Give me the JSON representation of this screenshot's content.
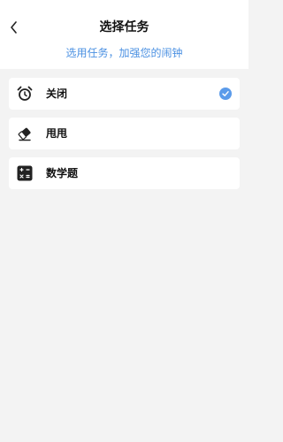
{
  "header": {
    "title": "选择任务",
    "subtitle": "选用任务，加强您的闹钟",
    "back_icon": "chevron-left-icon"
  },
  "tasks": [
    {
      "label": "关闭",
      "icon": "alarm-clock-icon",
      "selected": true
    },
    {
      "label": "甩甩",
      "icon": "eraser-icon",
      "selected": false
    },
    {
      "label": "数学题",
      "icon": "calculator-icon",
      "selected": false
    }
  ],
  "colors": {
    "accent": "#4a90e2",
    "check": "#5b9bea",
    "background": "#f3f3f3"
  }
}
